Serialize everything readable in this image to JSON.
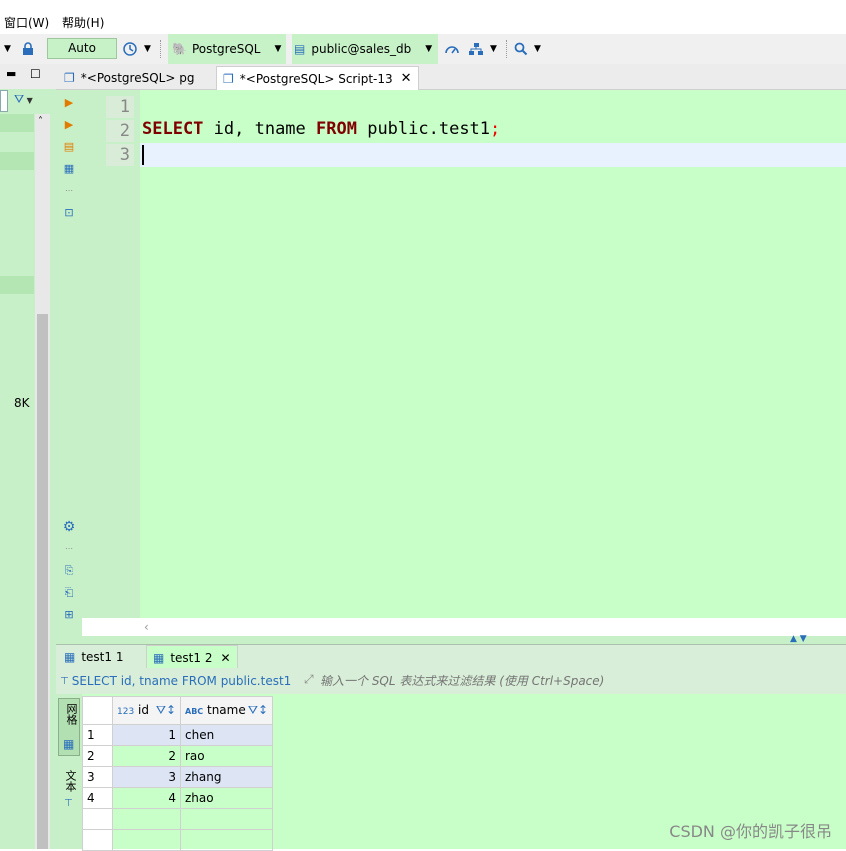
{
  "menu": {
    "window": "窗口(W)",
    "help": "帮助(H)"
  },
  "toolbar": {
    "auto_label": "Auto",
    "connection": "PostgreSQL",
    "database": "public@sales_db"
  },
  "left_panel": {
    "size_label": "8K"
  },
  "editor_tabs": [
    {
      "label": "*<PostgreSQL> pg"
    },
    {
      "label": "*<PostgreSQL> Script-13"
    }
  ],
  "editor": {
    "line_numbers": [
      "1",
      "2",
      "3"
    ],
    "code_keyword1": "SELECT",
    "code_mid": " id, tname ",
    "code_keyword2": "FROM",
    "code_rest": " public.test1",
    "code_semicolon": ";"
  },
  "result_tabs": [
    {
      "label": "test1 1"
    },
    {
      "label": "test1 2"
    }
  ],
  "filter": {
    "query": "SELECT id, tname FROM public.test1",
    "placeholder": "输入一个 SQL 表达式来过滤结果 (使用 Ctrl+Space)"
  },
  "grid": {
    "side_grid_label": "网格",
    "side_text_label": "文本",
    "columns": [
      {
        "type": "123",
        "name": "id"
      },
      {
        "type": "ABC",
        "name": "tname"
      }
    ],
    "rows": [
      {
        "num": "1",
        "id": "1",
        "tname": "chen"
      },
      {
        "num": "2",
        "id": "2",
        "tname": "rao"
      },
      {
        "num": "3",
        "id": "3",
        "tname": "zhang"
      },
      {
        "num": "4",
        "id": "4",
        "tname": "zhao"
      }
    ]
  },
  "watermark": "CSDN @你的凯子很吊",
  "colors": {
    "editor_bg": "#c8ffc8",
    "keyword": "#7f0000",
    "current_line": "#e8f2ff"
  }
}
